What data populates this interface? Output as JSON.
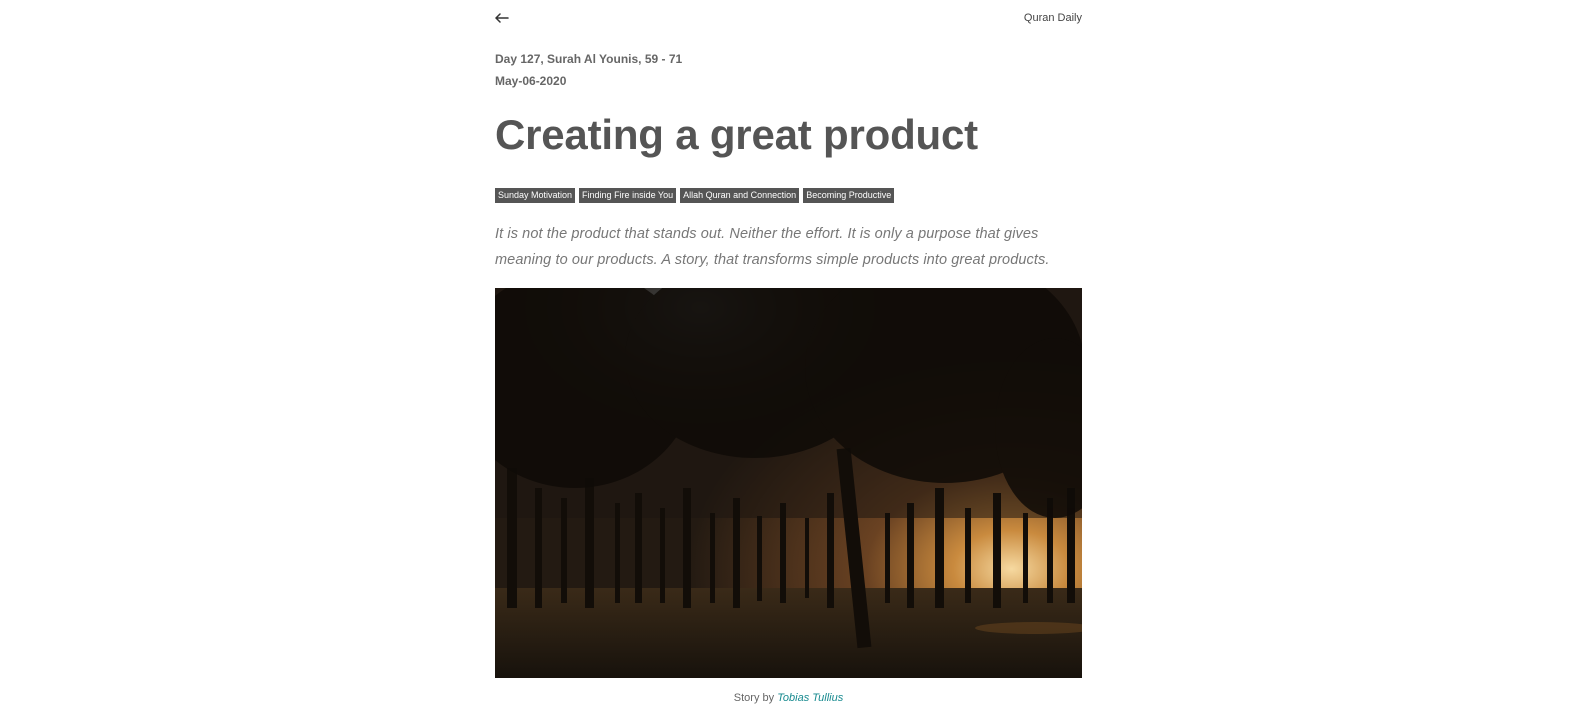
{
  "header": {
    "back_icon": "arrow-left-icon",
    "brand": "Quran Daily"
  },
  "post": {
    "day_info": "Day 127, Surah Al Younis, 59 - 71",
    "date": "May-06-2020",
    "title": "Creating a great product",
    "tags": [
      "Sunday Motivation",
      "Finding Fire inside You",
      "Allah Quran and Connection",
      "Becoming Productive"
    ],
    "lead": "It is not the product that stands out. Neither the effort. It is only a purpose that gives meaning to our products. A story, that transforms simple products into great products."
  },
  "image": {
    "description_icon": "forest-sunrise-photo"
  },
  "credit": {
    "prefix": "Story by",
    "author": "Tobias Tullius"
  },
  "colors": {
    "tag_bg": "#555555",
    "link": "#178a8f",
    "title": "#555555"
  }
}
